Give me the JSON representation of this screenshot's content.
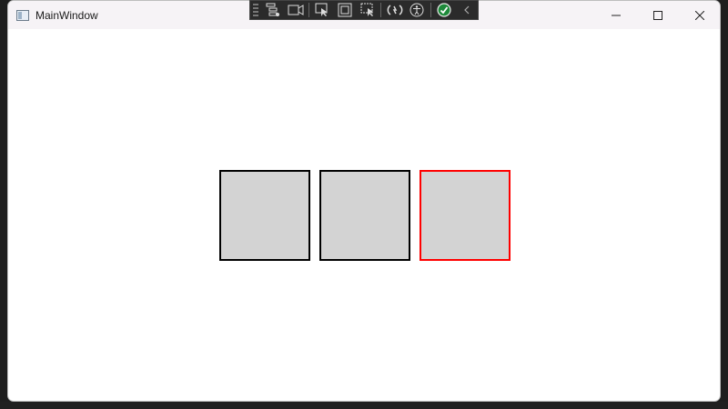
{
  "window": {
    "title": "MainWindow",
    "controls": {
      "minimize": "minimize",
      "maximize": "maximize",
      "close": "close"
    }
  },
  "debug_toolbar": {
    "icons": [
      "live-visual-tree-icon",
      "video-icon",
      "select-element-icon",
      "display-layout-adorners-icon",
      "track-focus-icon",
      "hot-reload-icon",
      "accessibility-icon",
      "binding-check-icon",
      "collapse-chevron-icon"
    ]
  },
  "content": {
    "squares": [
      {
        "fill": "#d3d3d3",
        "border": "#000000"
      },
      {
        "fill": "#d3d3d3",
        "border": "#000000"
      },
      {
        "fill": "#d3d3d3",
        "border": "#ff0000"
      }
    ]
  }
}
